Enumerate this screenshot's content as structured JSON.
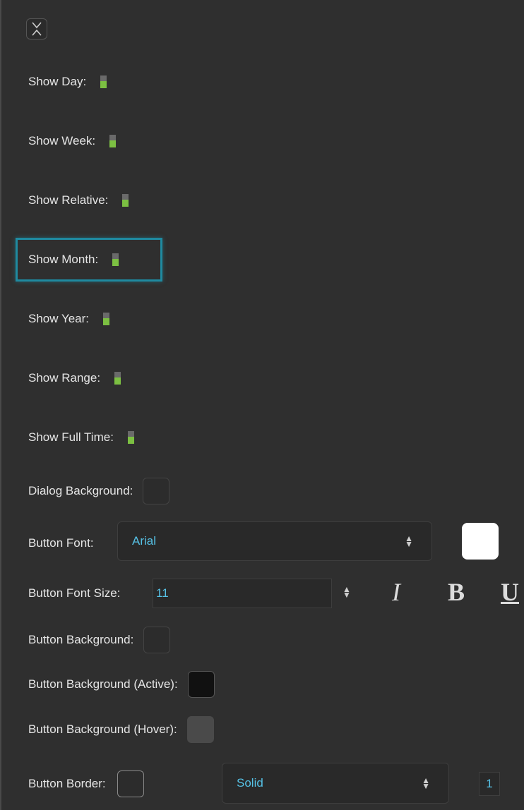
{
  "toggles": [
    {
      "label": "Show Day:",
      "on": true
    },
    {
      "label": "Show Week:",
      "on": true
    },
    {
      "label": "Show Relative:",
      "on": true
    },
    {
      "label": "Show Month:",
      "on": true
    },
    {
      "label": "Show Year:",
      "on": true
    },
    {
      "label": "Show Range:",
      "on": true
    },
    {
      "label": "Show Full Time:",
      "on": true
    }
  ],
  "dialog_background": {
    "label": "Dialog Background:",
    "color": "#2c2c2c"
  },
  "button_font": {
    "label": "Button Font:",
    "value": "Arial",
    "color_swatch": "#ffffff"
  },
  "button_font_size": {
    "label": "Button Font Size:",
    "value": "11",
    "italic": "I",
    "bold": "B",
    "underline": "U"
  },
  "button_background": {
    "label": "Button Background:",
    "color": "#2c2c2c"
  },
  "button_background_active": {
    "label": "Button Background (Active):",
    "color": "#111111"
  },
  "button_background_hover": {
    "label": "Button Background (Hover):",
    "color": "#4a4a4a"
  },
  "button_border": {
    "label": "Button Border:",
    "color": "#2c2c2c",
    "style": "Solid",
    "width": "1"
  },
  "colors": {
    "accent": "#56c2e6",
    "toggle_on": "#7cc042",
    "focus": "#1f8aa0"
  }
}
